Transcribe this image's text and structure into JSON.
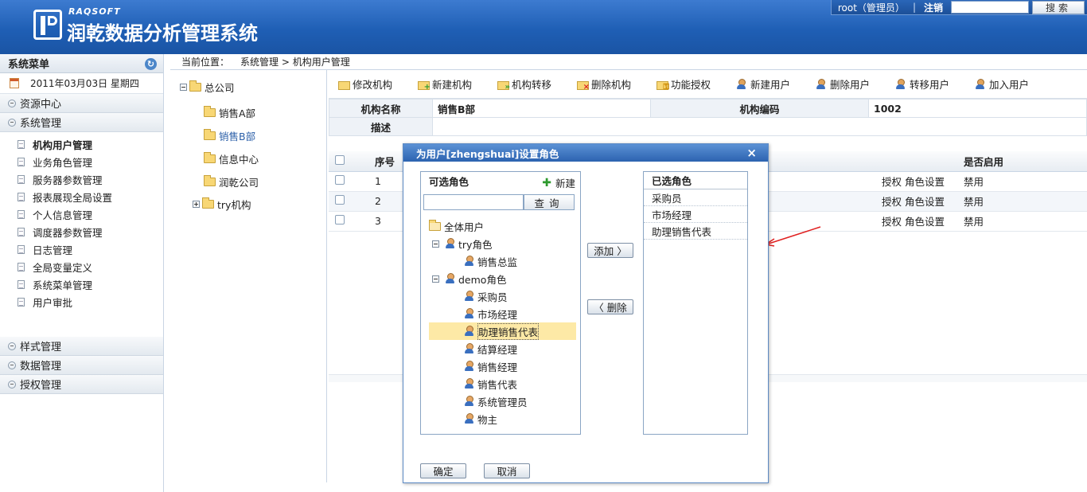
{
  "header": {
    "brand_en": "RAQSOFT",
    "brand_cn": "润乾数据分析管理系统",
    "user": "root（管理员）",
    "sep": "|",
    "logout": "注销",
    "search_btn": "搜索"
  },
  "leftmenu": {
    "title": "系统菜单",
    "date": "2011年03月03日 星期四",
    "groups_top": [
      "资源中心",
      "系统管理"
    ],
    "items": [
      "机构用户管理",
      "业务角色管理",
      "服务器参数管理",
      "报表展现全局设置",
      "个人信息管理",
      "调度器参数管理",
      "日志管理",
      "全局变量定义",
      "系统菜单管理",
      "用户审批"
    ],
    "groups_bottom": [
      "样式管理",
      "数据管理",
      "授权管理"
    ]
  },
  "breadcrumb": {
    "label": "当前位置：",
    "path": "系统管理 > 机构用户管理"
  },
  "orgtree": {
    "root": "总公司",
    "children": [
      "销售A部",
      "销售B部",
      "信息中心",
      "润乾公司",
      "try机构"
    ]
  },
  "toolbar": [
    "修改机构",
    "新建机构",
    "机构转移",
    "删除机构",
    "功能授权",
    "新建用户",
    "删除用户",
    "转移用户",
    "加入用户"
  ],
  "info": {
    "name_label": "机构名称",
    "name_value": "销售B部",
    "code_label": "机构编码",
    "code_value": "1002",
    "desc_label": "描述"
  },
  "usertable": {
    "col_seq": "序号",
    "col_enable": "是否启用",
    "rows": [
      {
        "seq": "1",
        "ops": "授权 角色设置",
        "enable": "禁用"
      },
      {
        "seq": "2",
        "ops": "授权 角色设置",
        "enable": "禁用"
      },
      {
        "seq": "3",
        "ops": "授权 角色设置",
        "enable": "禁用"
      }
    ]
  },
  "modal": {
    "title": "为用户[zhengshuai]设置角色",
    "close": "×",
    "left_title": "可选角色",
    "new_label": "新建",
    "query_btn": "查询",
    "tree": {
      "all": "全体用户",
      "try_role": "try角色",
      "try_children": [
        "销售总监"
      ],
      "demo_role": "demo角色",
      "demo_children": [
        "采购员",
        "市场经理",
        "助理销售代表",
        "结算经理",
        "销售经理",
        "销售代表",
        "系统管理员",
        "物主"
      ]
    },
    "right_title": "已选角色",
    "selected": [
      "采购员",
      "市场经理",
      "助理销售代表"
    ],
    "add_btn": "添加 〉",
    "del_btn": "〈 删除",
    "ok_btn": "确定",
    "cancel_btn": "取消"
  },
  "colors": {
    "header_blue": "#1f5fb5",
    "highlight": "#fde9a6",
    "arrow_red": "#e02020"
  }
}
